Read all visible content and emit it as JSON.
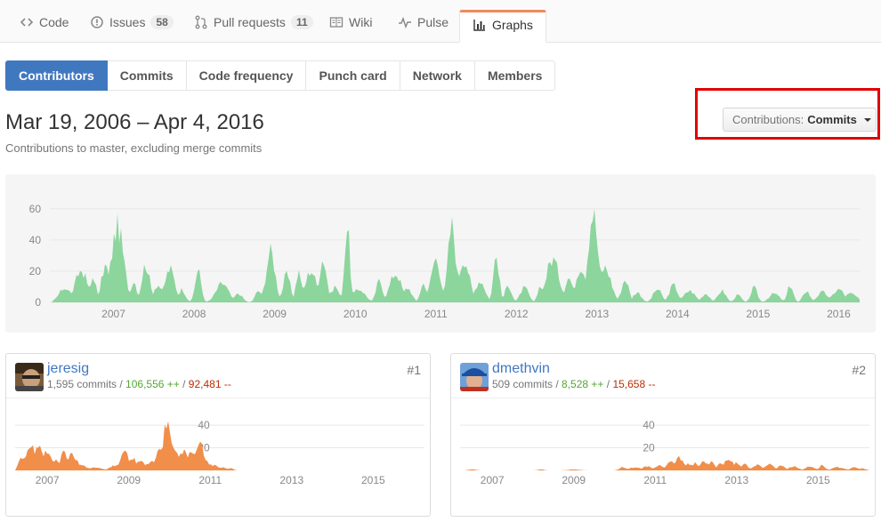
{
  "reponav": {
    "code": "Code",
    "issues": "Issues",
    "issues_count": "58",
    "pulls": "Pull requests",
    "pulls_count": "11",
    "wiki": "Wiki",
    "pulse": "Pulse",
    "graphs": "Graphs"
  },
  "subnav": [
    "Contributors",
    "Commits",
    "Code frequency",
    "Punch card",
    "Network",
    "Members"
  ],
  "header": {
    "date_range": "Mar 19, 2006 – Apr 4, 2016",
    "subtitle": "Contributions to master, excluding merge commits"
  },
  "contributions_select": {
    "label": "Contributions:",
    "value": "Commits"
  },
  "colors": {
    "main_area": "#8cd59d",
    "contributor_area": "#f08e4a",
    "link": "#4078c0",
    "highlight": "#e00000"
  },
  "chart_data": [
    {
      "type": "area",
      "ylim": [
        0,
        65
      ],
      "y_ticks": [
        "0",
        "20",
        "40",
        "60"
      ],
      "x_ticks": [
        "2007",
        "2008",
        "2009",
        "2010",
        "2011",
        "2012",
        "2013",
        "2014",
        "2015",
        "2016"
      ],
      "x_start": 2006.21,
      "x_end": 2016.26,
      "peaks": [
        [
          2006.4,
          10
        ],
        [
          2006.6,
          22
        ],
        [
          2006.75,
          18
        ],
        [
          2006.9,
          25
        ],
        [
          2007.05,
          52
        ],
        [
          2007.25,
          15
        ],
        [
          2007.4,
          26
        ],
        [
          2007.55,
          12
        ],
        [
          2007.7,
          23
        ],
        [
          2007.85,
          9
        ],
        [
          2008.05,
          22
        ],
        [
          2008.35,
          13
        ],
        [
          2008.55,
          6
        ],
        [
          2008.8,
          8
        ],
        [
          2008.95,
          35
        ],
        [
          2009.15,
          19
        ],
        [
          2009.3,
          21
        ],
        [
          2009.45,
          22
        ],
        [
          2009.6,
          30
        ],
        [
          2009.75,
          11
        ],
        [
          2009.9,
          52
        ],
        [
          2010.05,
          9
        ],
        [
          2010.3,
          15
        ],
        [
          2010.5,
          20
        ],
        [
          2010.65,
          10
        ],
        [
          2010.85,
          13
        ],
        [
          2011.0,
          30
        ],
        [
          2011.2,
          53
        ],
        [
          2011.35,
          30
        ],
        [
          2011.55,
          15
        ],
        [
          2011.75,
          32
        ],
        [
          2011.9,
          12
        ],
        [
          2012.1,
          10
        ],
        [
          2012.3,
          12
        ],
        [
          2012.45,
          30
        ],
        [
          2012.65,
          17
        ],
        [
          2012.8,
          25
        ],
        [
          2012.95,
          62
        ],
        [
          2013.1,
          24
        ],
        [
          2013.35,
          16
        ],
        [
          2013.5,
          7
        ],
        [
          2013.75,
          9
        ],
        [
          2013.95,
          12
        ],
        [
          2014.15,
          8
        ],
        [
          2014.35,
          6
        ],
        [
          2014.55,
          8
        ],
        [
          2014.75,
          5
        ],
        [
          2014.95,
          10
        ],
        [
          2015.2,
          6
        ],
        [
          2015.4,
          12
        ],
        [
          2015.6,
          8
        ],
        [
          2015.8,
          7
        ],
        [
          2016.0,
          9
        ],
        [
          2016.15,
          6
        ]
      ]
    },
    {
      "type": "area",
      "ylim": [
        0,
        55
      ],
      "y_ticks": [
        "20",
        "40"
      ],
      "x_ticks": [
        "2007",
        "2009",
        "2011",
        "2013",
        "2015"
      ],
      "x_start": 2006.21,
      "x_end": 2016.26,
      "peaks": [
        [
          2006.4,
          12
        ],
        [
          2006.6,
          22
        ],
        [
          2006.8,
          26
        ],
        [
          2007.0,
          18
        ],
        [
          2007.2,
          10
        ],
        [
          2007.4,
          20
        ],
        [
          2007.6,
          15
        ],
        [
          2007.85,
          5
        ],
        [
          2008.2,
          3
        ],
        [
          2008.7,
          5
        ],
        [
          2008.9,
          18
        ],
        [
          2009.1,
          12
        ],
        [
          2009.3,
          10
        ],
        [
          2009.55,
          8
        ],
        [
          2009.75,
          20
        ],
        [
          2009.95,
          45
        ],
        [
          2010.15,
          22
        ],
        [
          2010.35,
          18
        ],
        [
          2010.55,
          20
        ],
        [
          2010.75,
          25
        ],
        [
          2010.9,
          8
        ],
        [
          2011.1,
          5
        ],
        [
          2011.3,
          3
        ],
        [
          2011.5,
          2
        ]
      ]
    },
    {
      "type": "area",
      "ylim": [
        0,
        55
      ],
      "y_ticks": [
        "20",
        "40"
      ],
      "x_ticks": [
        "2007",
        "2009",
        "2011",
        "2013",
        "2015"
      ],
      "x_start": 2006.21,
      "x_end": 2016.26,
      "peaks": [
        [
          2006.5,
          1
        ],
        [
          2008.2,
          1
        ],
        [
          2009.0,
          1
        ],
        [
          2010.2,
          3
        ],
        [
          2010.5,
          3
        ],
        [
          2010.8,
          4
        ],
        [
          2011.1,
          5
        ],
        [
          2011.4,
          8
        ],
        [
          2011.6,
          12
        ],
        [
          2011.8,
          6
        ],
        [
          2012.0,
          7
        ],
        [
          2012.2,
          8
        ],
        [
          2012.4,
          9
        ],
        [
          2012.6,
          7
        ],
        [
          2012.8,
          10
        ],
        [
          2013.0,
          8
        ],
        [
          2013.2,
          7
        ],
        [
          2013.5,
          5
        ],
        [
          2013.8,
          6
        ],
        [
          2014.1,
          5
        ],
        [
          2014.4,
          4
        ],
        [
          2014.8,
          4
        ],
        [
          2015.1,
          5
        ],
        [
          2015.5,
          3
        ],
        [
          2015.9,
          3
        ],
        [
          2016.1,
          2
        ]
      ]
    }
  ],
  "contributors": [
    {
      "name": "jeresig",
      "commits": "1,595 commits",
      "additions": "106,556 ++",
      "deletions": "92,481 --",
      "rank": "#1"
    },
    {
      "name": "dmethvin",
      "commits": "509 commits",
      "additions": "8,528 ++",
      "deletions": "15,658 --",
      "rank": "#2"
    }
  ]
}
